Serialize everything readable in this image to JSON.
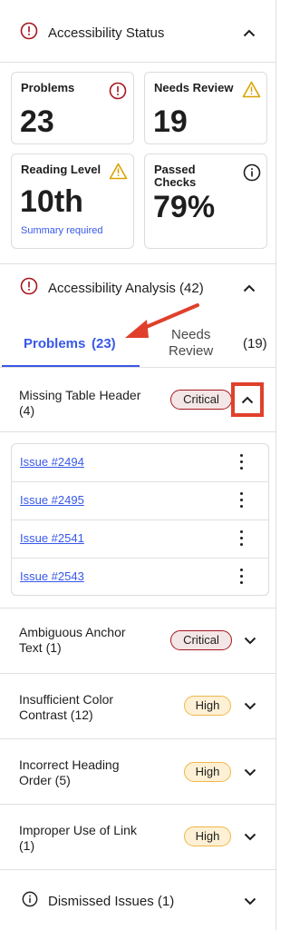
{
  "status_section": {
    "title": "Accessibility Status",
    "cards": [
      {
        "label": "Problems",
        "value": "23",
        "icon": "error-icon"
      },
      {
        "label": "Needs Review",
        "value": "19",
        "icon": "warning-icon"
      },
      {
        "label": "Reading Level",
        "value": "10th",
        "sub": "Summary required",
        "icon": "warning-icon"
      },
      {
        "label_line1": "Passed",
        "label_line2": "Checks",
        "value": "79%",
        "icon": "info-icon"
      }
    ]
  },
  "analysis_section": {
    "title": "Accessibility Analysis (42)"
  },
  "tabs": {
    "problems_label": "Problems",
    "problems_count": "(23)",
    "review_line1": "Needs",
    "review_line2": "Review",
    "review_count": "(19)"
  },
  "groups": [
    {
      "line1": "Missing Table Header",
      "line2": "(4)",
      "severity": "Critical",
      "expanded": true
    },
    {
      "line1": "Ambiguous Anchor",
      "line2": "Text (1)",
      "severity": "Critical",
      "expanded": false
    },
    {
      "line1": "Insufficient Color",
      "line2": "Contrast (12)",
      "severity": "High",
      "expanded": false
    },
    {
      "line1": "Incorrect Heading",
      "line2": "Order (5)",
      "severity": "High",
      "expanded": false
    },
    {
      "line1": "Improper Use of Link",
      "line2": "(1)",
      "severity": "High",
      "expanded": false
    }
  ],
  "issues": [
    "Issue #2494",
    "Issue #2495",
    "Issue #2541",
    "Issue #2543"
  ],
  "dismissed": {
    "title": "Dismissed Issues (1)"
  },
  "colors": {
    "accent": "#3858e9",
    "critical": "#a6171e",
    "high": "#f0b849",
    "annotation": "#e0402b"
  }
}
